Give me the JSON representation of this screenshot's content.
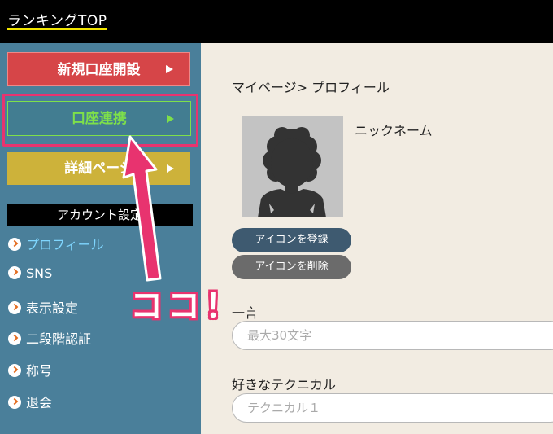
{
  "header": {
    "title": "ランキングTOP"
  },
  "sidebar": {
    "buttons": [
      {
        "label": "新規口座開設"
      },
      {
        "label": "口座連携"
      },
      {
        "label": "詳細ページ"
      }
    ],
    "account_header": "アカウント設定",
    "items": [
      {
        "label": "プロフィール"
      },
      {
        "label": "SNS"
      },
      {
        "label": "表示設定"
      },
      {
        "label": "二段階認証"
      },
      {
        "label": "称号"
      },
      {
        "label": "退会"
      }
    ]
  },
  "main": {
    "breadcrumb": "マイページ> プロフィール",
    "nickname": "ニックネーム",
    "register_icon": "アイコンを登録",
    "delete_icon": "アイコンを削除",
    "hitokoto_label": "一言",
    "hitokoto_placeholder": "最大30文字",
    "technical_label": "好きなテクニカル",
    "technical_placeholder": "テクニカル１"
  },
  "annotation": {
    "text": "ココ！"
  },
  "colors": {
    "accent_pink": "#e8336f",
    "sidebar_bg": "#4a7f9a",
    "red_button": "#d64548",
    "yellow_button": "#cdb23a",
    "link_active": "#7fd6ff"
  }
}
